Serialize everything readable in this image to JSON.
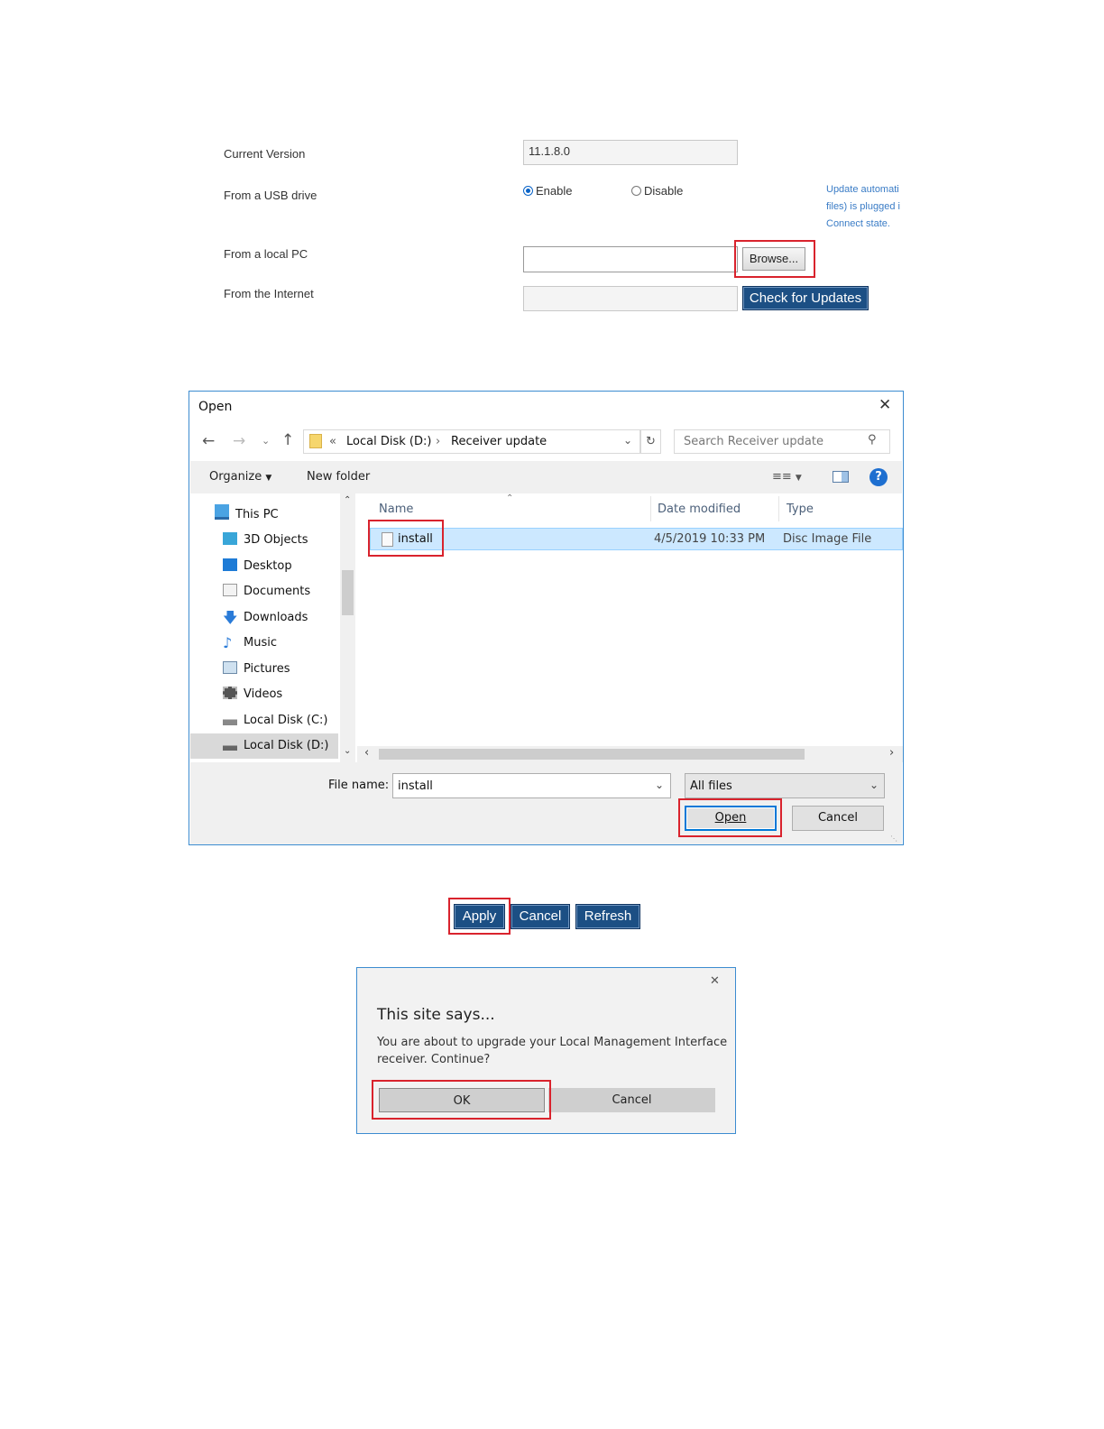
{
  "update_form": {
    "current_version_label": "Current Version",
    "current_version_value": "11.1.8.0",
    "usb_label": "From a USB drive",
    "usb_enable_label": "Enable",
    "usb_disable_label": "Disable",
    "usb_selected": "Enable",
    "usb_note_lines": [
      "Update automati",
      "files) is plugged i",
      "Connect state."
    ],
    "local_pc_label": "From a local PC",
    "local_pc_value": "",
    "browse_label": "Browse...",
    "internet_label": "From the Internet",
    "internet_value": "",
    "check_updates_label": "Check for Updates"
  },
  "open_dialog": {
    "title": "Open",
    "close_glyph": "✕",
    "address": {
      "prefix": "«",
      "segments": [
        "Local Disk (D:)",
        "Receiver update"
      ]
    },
    "search_placeholder": "Search Receiver update",
    "toolbar": {
      "organize_label": "Organize",
      "new_folder_label": "New folder"
    },
    "tree": [
      {
        "label": "This PC",
        "icon": "computer-icon"
      },
      {
        "label": "3D Objects",
        "icon": "cube-icon"
      },
      {
        "label": "Desktop",
        "icon": "desktop-icon"
      },
      {
        "label": "Documents",
        "icon": "document-icon"
      },
      {
        "label": "Downloads",
        "icon": "download-icon"
      },
      {
        "label": "Music",
        "icon": "music-icon"
      },
      {
        "label": "Pictures",
        "icon": "pictures-icon"
      },
      {
        "label": "Videos",
        "icon": "video-icon"
      },
      {
        "label": "Local Disk (C:)",
        "icon": "drive-icon"
      },
      {
        "label": "Local Disk (D:)",
        "icon": "drive-icon",
        "selected": true
      }
    ],
    "columns": {
      "name": "Name",
      "date": "Date modified",
      "type": "Type"
    },
    "files": [
      {
        "name": "install",
        "date": "4/5/2019 10:33 PM",
        "type": "Disc Image File",
        "selected": true
      }
    ],
    "file_name_label": "File name:",
    "file_name_value": "install",
    "filter_value": "All files",
    "open_label": "Open",
    "cancel_label": "Cancel"
  },
  "action_buttons": {
    "apply_label": "Apply",
    "cancel_label": "Cancel",
    "refresh_label": "Refresh"
  },
  "confirm_dialog": {
    "close_glyph": "✕",
    "title": "This site says...",
    "message_line1": "You are about to upgrade your Local Management Interface",
    "message_line2": "receiver. Continue?",
    "ok_label": "OK",
    "cancel_label": "Cancel"
  },
  "colors": {
    "accent_red": "#d9232d",
    "button_blue": "#1c4f84",
    "selection_blue": "#cce8ff",
    "link_blue": "#3a7cc6"
  }
}
